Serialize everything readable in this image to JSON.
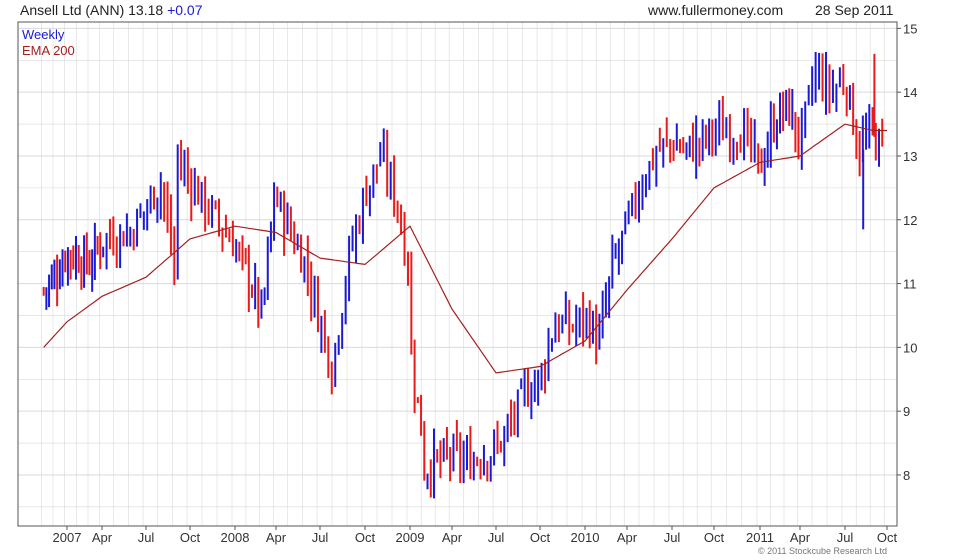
{
  "header": {
    "security": "Ansell Ltd (ANN) 13.18",
    "change": "+0.07",
    "site": "www.fullermoney.com",
    "date": "28 Sep 2011"
  },
  "legend": {
    "weekly": "Weekly",
    "ema": "EMA 200"
  },
  "copyright": "© 2011 Stockcube Research Ltd",
  "colors": {
    "up": "#1a1ad6",
    "down": "#e81a1a",
    "ema": "#a42020",
    "grid": "#d9d9d9",
    "axis": "#555555"
  },
  "chart_data": {
    "type": "candlestick",
    "title": "Ansell Ltd (ANN) 13.18 +0.07",
    "timeframe": "Weekly",
    "yaxis_side": "right",
    "ylim": [
      7.2,
      15.1
    ],
    "yticks": [
      8,
      9,
      10,
      11,
      12,
      13,
      14,
      15
    ],
    "xticks": [
      "2007",
      "Apr",
      "Jul",
      "Oct",
      "2008",
      "Apr",
      "Jul",
      "Oct",
      "2009",
      "Apr",
      "Jul",
      "Oct",
      "2010",
      "Apr",
      "Jul",
      "Oct",
      "2011",
      "Apr",
      "Jul",
      "Oct"
    ],
    "grid": true,
    "legend_position": "top-left",
    "series": [
      {
        "name": "Weekly",
        "price_path_approx": [
          [
            "Nov 2006",
            10.9
          ],
          [
            "Dec 2006",
            11.1
          ],
          [
            "Jan 2007",
            11.5
          ],
          [
            "Mar 2007",
            11.3
          ],
          [
            "Apr 2007",
            11.7
          ],
          [
            "Jun 2007",
            11.8
          ],
          [
            "Jul 2007",
            12.2
          ],
          [
            "Aug 2007",
            12.6
          ],
          [
            "Sep 2007",
            11.2
          ],
          [
            "Sep 2007",
            13.0
          ],
          [
            "Oct 2007",
            12.6
          ],
          [
            "Dec 2007",
            11.9
          ],
          [
            "Jan 2008",
            11.6
          ],
          [
            "Feb 2008",
            11.1
          ],
          [
            "Mar 2008",
            10.5
          ],
          [
            "Apr 2008",
            12.7
          ],
          [
            "Apr 2008",
            12.3
          ],
          [
            "May 2008",
            11.8
          ],
          [
            "Jun 2008",
            11.3
          ],
          [
            "Jul 2008",
            10.4
          ],
          [
            "Aug 2008",
            9.5
          ],
          [
            "Aug 2008",
            10.0
          ],
          [
            "Sep 2008",
            11.5
          ],
          [
            "Oct 2008",
            12.4
          ],
          [
            "Nov 2008",
            13.0
          ],
          [
            "Dec 2008",
            12.4
          ],
          [
            "Jan 2009",
            11.2
          ],
          [
            "Jan 2009",
            10.0
          ],
          [
            "Feb 2009",
            8.4
          ],
          [
            "Feb 2009",
            8.1
          ],
          [
            "Mar 2009",
            8.2
          ],
          [
            "Apr 2009",
            8.3
          ],
          [
            "May 2009",
            8.2
          ],
          [
            "Jun 2009",
            8.3
          ],
          [
            "Jul 2009",
            8.4
          ],
          [
            "Aug 2009",
            8.8
          ],
          [
            "Sep 2009",
            9.3
          ],
          [
            "Oct 2009",
            9.5
          ],
          [
            "Nov 2009",
            10.4
          ],
          [
            "Dec 2009",
            10.3
          ],
          [
            "Jan 2010",
            10.5
          ],
          [
            "Feb 2010",
            10.1
          ],
          [
            "Mar 2010",
            11.3
          ],
          [
            "Apr 2010",
            11.9
          ],
          [
            "May 2010",
            12.6
          ],
          [
            "Jun 2010",
            13.1
          ],
          [
            "Jul 2010",
            13.2
          ],
          [
            "Aug 2010",
            13.1
          ],
          [
            "Sep 2010",
            13.2
          ],
          [
            "Oct 2010",
            13.4
          ],
          [
            "Nov 2010",
            13.4
          ],
          [
            "Dec 2010",
            13.3
          ],
          [
            "Jan 2011",
            12.8
          ],
          [
            "Feb 2011",
            13.5
          ],
          [
            "Mar 2011",
            13.8
          ],
          [
            "Apr 2011",
            13.2
          ],
          [
            "May 2011",
            14.3
          ],
          [
            "Jun 2011",
            14.0
          ],
          [
            "Jul 2011",
            14.2
          ],
          [
            "Aug 2011",
            13.1
          ],
          [
            "Sep 2011",
            13.4
          ],
          [
            "Sep 2011",
            13.18
          ]
        ]
      },
      {
        "name": "EMA 200",
        "path_approx": [
          [
            "Nov 2006",
            10.0
          ],
          [
            "Jan 2007",
            10.4
          ],
          [
            "Apr 2007",
            10.8
          ],
          [
            "Jul 2007",
            11.1
          ],
          [
            "Oct 2007",
            11.7
          ],
          [
            "Jan 2008",
            11.9
          ],
          [
            "Apr 2008",
            11.8
          ],
          [
            "Jul 2008",
            11.4
          ],
          [
            "Oct 2008",
            11.3
          ],
          [
            "Jan 2009",
            11.9
          ],
          [
            "Apr 2009",
            10.6
          ],
          [
            "Jul 2009",
            9.6
          ],
          [
            "Oct 2009",
            9.7
          ],
          [
            "Jan 2010",
            10.1
          ],
          [
            "Apr 2010",
            10.9
          ],
          [
            "Jul 2010",
            11.7
          ],
          [
            "Oct 2010",
            12.5
          ],
          [
            "Jan 2011",
            12.9
          ],
          [
            "Apr 2011",
            13.0
          ],
          [
            "Jul 2011",
            13.5
          ],
          [
            "Sep 2011",
            13.4
          ]
        ]
      }
    ]
  }
}
